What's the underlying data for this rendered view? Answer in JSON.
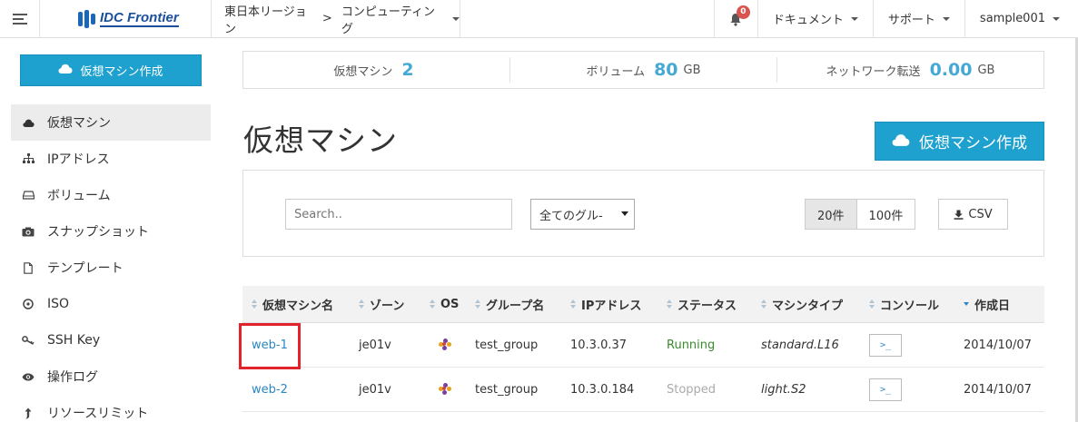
{
  "topnav": {
    "logo_text": "IDC Frontier",
    "region": "東日本リージョン",
    "separator": ">",
    "service": "コンピューティング",
    "notification_count": "0",
    "documents": "ドキュメント",
    "support": "サポート",
    "user": "sample001"
  },
  "sidebar": {
    "create_button": "仮想マシン作成",
    "items": [
      {
        "label": "仮想マシン",
        "icon": "cloud-icon"
      },
      {
        "label": "IPアドレス",
        "icon": "sitemap-icon"
      },
      {
        "label": "ボリューム",
        "icon": "hdd-icon"
      },
      {
        "label": "スナップショット",
        "icon": "camera-icon"
      },
      {
        "label": "テンプレート",
        "icon": "file-icon"
      },
      {
        "label": "ISO",
        "icon": "disc-icon"
      },
      {
        "label": "SSH Key",
        "icon": "key-icon"
      },
      {
        "label": "操作ログ",
        "icon": "eye-icon"
      },
      {
        "label": "リソースリミット",
        "icon": "arrow-up-icon"
      }
    ]
  },
  "summary": {
    "vm_label": "仮想マシン",
    "vm_value": "2",
    "volume_label": "ボリューム",
    "volume_value": "80",
    "volume_unit": "GB",
    "network_label": "ネットワーク転送",
    "network_value": "0.00",
    "network_unit": "GB"
  },
  "main": {
    "title": "仮想マシン",
    "create_button": "仮想マシン作成"
  },
  "filters": {
    "search_placeholder": "Search..",
    "group_select": "全てのグル-",
    "perpage_20": "20件",
    "perpage_100": "100件",
    "csv": "CSV"
  },
  "table": {
    "headers": [
      "仮想マシン名",
      "ゾーン",
      "OS",
      "グループ名",
      "IPアドレス",
      "ステータス",
      "マシンタイプ",
      "コンソール",
      "作成日"
    ],
    "rows": [
      {
        "name": "web-1",
        "zone": "je01v",
        "group": "test_group",
        "ip": "10.3.0.37",
        "status": "Running",
        "type": "standard.L16",
        "console": ">_",
        "created": "2014/10/07"
      },
      {
        "name": "web-2",
        "zone": "je01v",
        "group": "test_group",
        "ip": "10.3.0.184",
        "status": "Stopped",
        "type": "light.S2",
        "console": ">_",
        "created": "2014/10/07"
      }
    ]
  },
  "colors": {
    "accent": "#1fa1d0",
    "link": "#2a87c4",
    "running": "#3a8a2e",
    "stopped": "#aaaaaa",
    "highlight": "#e2232a",
    "badge": "#d9534f"
  }
}
